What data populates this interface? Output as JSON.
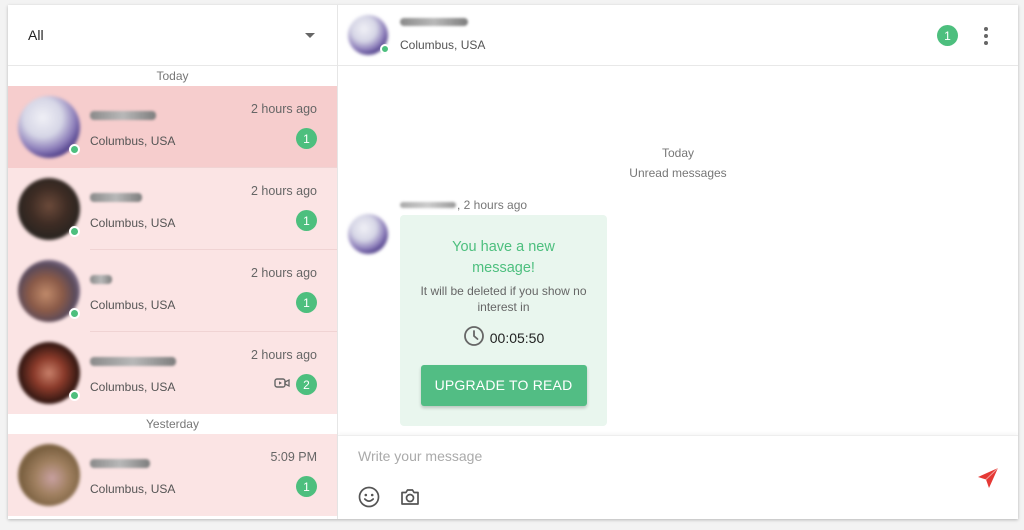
{
  "filter": {
    "selected": "All"
  },
  "sidebar": {
    "groups": [
      {
        "label": "Today",
        "conversations": [
          {
            "name_blurred": true,
            "location": "Columbus, USA",
            "time": "2 hours ago",
            "unread": "1",
            "online": true,
            "active": true,
            "video": false
          },
          {
            "name_blurred": true,
            "location": "Columbus, USA",
            "time": "2 hours ago",
            "unread": "1",
            "online": true,
            "active": false,
            "video": false
          },
          {
            "name_blurred": true,
            "location": "Columbus, USA",
            "time": "2 hours ago",
            "unread": "1",
            "online": true,
            "active": false,
            "video": false
          },
          {
            "name_blurred": true,
            "location": "Columbus, USA",
            "time": "2 hours ago",
            "unread": "2",
            "online": true,
            "active": false,
            "video": true
          }
        ]
      },
      {
        "label": "Yesterday",
        "conversations": [
          {
            "name_blurred": true,
            "location": "Columbus, USA",
            "time": "5:09 PM",
            "unread": "1",
            "online": false,
            "active": false,
            "video": false
          }
        ]
      }
    ]
  },
  "header": {
    "location": "Columbus, USA",
    "unread": "1",
    "icons": [
      "online-dot",
      "more-vert-icon"
    ]
  },
  "chat": {
    "day_label": "Today",
    "unread_label": "Unread messages",
    "message": {
      "time_suffix": ", 2 hours ago",
      "title": "You have a new message!",
      "subtitle": "It will be deleted if you show no interest in",
      "timer": "00:05:50",
      "button": "UPGRADE TO READ"
    }
  },
  "composer": {
    "placeholder": "Write your message",
    "value": "",
    "icons": [
      "emoji-icon",
      "camera-icon",
      "send-icon"
    ]
  },
  "colors": {
    "accent_green": "#4dbf7e",
    "active_row": "#f6cdcd",
    "row": "#fbe4e4",
    "bubble": "#e9f6ee",
    "send_red": "#e53935"
  }
}
